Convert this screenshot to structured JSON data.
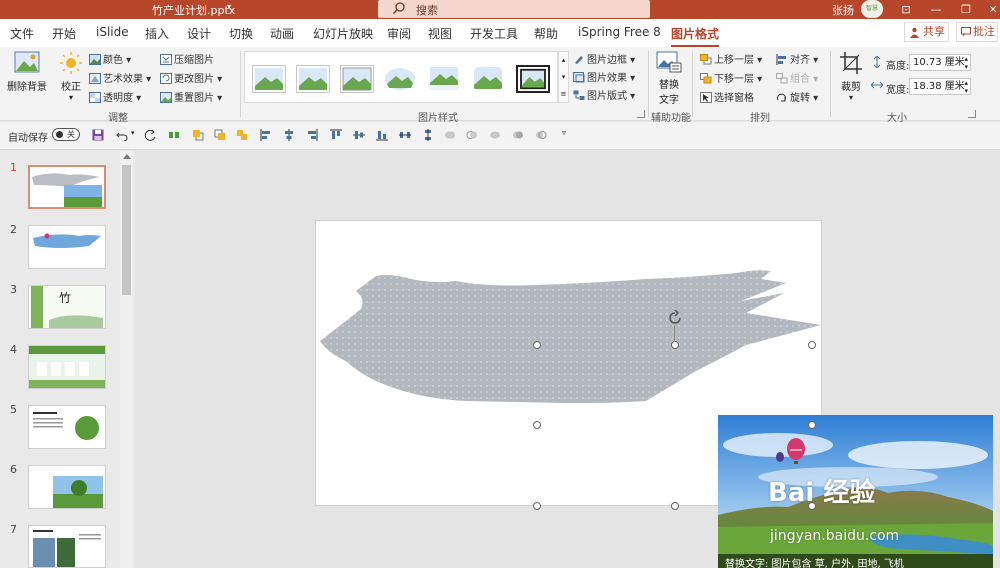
{
  "titlebar": {
    "doc_title": "竹产业计划.pptx",
    "caret": "▾",
    "search_placeholder": "搜索",
    "user": "张扬",
    "avatar_text": "智慧",
    "btn_ribbon": "⊡",
    "btn_min": "—",
    "btn_max": "❐",
    "btn_close": "✕"
  },
  "tabs": [
    "文件",
    "开始",
    "iSlide",
    "插入",
    "设计",
    "切换",
    "动画",
    "幻灯片放映",
    "审阅",
    "视图",
    "开发工具",
    "帮助",
    "iSpring Free 8",
    "图片格式"
  ],
  "tab_share": "共享",
  "tab_comment": "批注",
  "ribbon": {
    "remove_bg": "删除背景",
    "corrections": "校正",
    "color": "颜色",
    "artistic": "艺术效果",
    "transparency": "透明度",
    "compress": "压缩图片",
    "change": "更改图片",
    "reset": "重置图片",
    "group_adjust": "调整",
    "border": "图片边框",
    "effects": "图片效果",
    "layout": "图片版式",
    "group_styles": "图片样式",
    "alt_text_l1": "替换",
    "alt_text_l2": "文字",
    "group_access": "辅助功能",
    "bring_forward": "上移一层",
    "send_backward": "下移一层",
    "selection_pane": "选择窗格",
    "align": "对齐",
    "group_btn": "组合",
    "rotate": "旋转",
    "group_arrange": "排列",
    "crop": "裁剪",
    "height_label": "高度:",
    "height_value": "10.73 厘米",
    "width_label": "宽度:",
    "width_value": "18.38 厘米",
    "group_size": "大小"
  },
  "qat": {
    "autosave": "自动保存",
    "toggle": "关"
  },
  "thumbnails": [
    "1",
    "2",
    "3",
    "4",
    "5",
    "6",
    "7"
  ],
  "slide": {
    "alt_text": "替换文字: 图片包含 草, 户外, 田地, 飞机"
  },
  "watermark": {
    "logo": "Bai 经验",
    "url": "jingyan.baidu.com"
  },
  "colors": {
    "accent": "#b7472a",
    "titlebar": "#b7472a"
  }
}
